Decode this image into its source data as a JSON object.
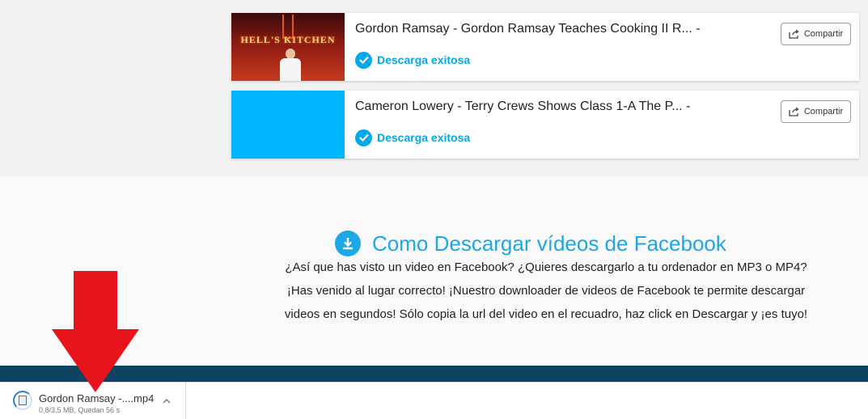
{
  "downloads": [
    {
      "title": "Gordon Ramsay - Gordon Ramsay Teaches Cooking II R... -",
      "status": "Descarga exitosa",
      "share_label": "Compartir",
      "thumbnail_sign": "HELL'S KITCHEN"
    },
    {
      "title": "Cameron Lowery - Terry Crews Shows Class 1-A The P... -",
      "status": "Descarga exitosa",
      "share_label": "Compartir"
    }
  ],
  "howto": {
    "title": "Como Descargar vídeos de Facebook",
    "lines": [
      "¿Así que has visto un video en Facebook? ¿Quieres descargarlo a tu ordenador en MP3 o MP4?",
      "¡Has venido al lugar correcto! ¡Nuestro downloader de videos de Facebook te permite descargar",
      "videos en segundos! Sólo copia la url del video en el recuadro, haz click en Descargar y ¡es tuyo!"
    ]
  },
  "download_shelf": {
    "file_name": "Gordon Ramsay -....mp4",
    "progress": "0,8/3,5 MB, Quedan 56 s"
  },
  "colors": {
    "accent": "#1ca8e6",
    "status": "#00a8ec",
    "footer": "#0d4461",
    "arrow": "#e8141c"
  }
}
